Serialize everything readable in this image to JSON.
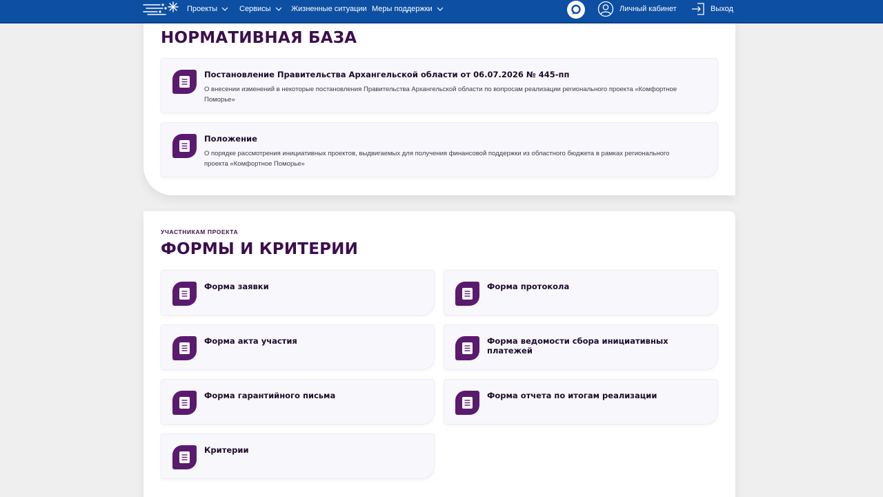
{
  "colors": {
    "header_bg": "#0d4fa3",
    "accent": "#3d0e4d",
    "icon_bg": "#5a1a6e",
    "card_bg": "#f8f8fc",
    "page_bg": "#efefef"
  },
  "icons": {
    "logo": "snowflake-logo-icon",
    "chat": "chat-bubble-icon",
    "account": "user-circle-icon",
    "logout": "logout-icon",
    "document": "document-icon",
    "dropdown": "chevron-down-icon"
  },
  "header": {
    "nav": [
      {
        "label": "Проекты",
        "has_dropdown": true
      },
      {
        "label": "Сервисы",
        "has_dropdown": true
      },
      {
        "label": "Жизненные ситуации",
        "has_dropdown": false
      },
      {
        "label": "Меры поддержки",
        "has_dropdown": true
      }
    ],
    "account_label": "Личный кабинет",
    "logout_label": "Выход"
  },
  "normative": {
    "title": "НОРМАТИВНАЯ БАЗА",
    "docs": [
      {
        "title": "Постановление Правительства Архангельской области от 06.07.2026 № 445-пп",
        "description": "О внесении изменений в некоторые постановления Правительства Архангельской области по вопросам реализации регионального проекта «Комфортное Поморье»"
      },
      {
        "title": "Положение",
        "description": "О порядке рассмотрения инициативных проектов, выдвигаемых для получения финансовой поддержки из областного бюджета в рамках регионального проекта «Комфортное Поморье»"
      }
    ]
  },
  "forms": {
    "eyebrow": "УЧАСТНИКАМ ПРОЕКТА",
    "title": "ФОРМЫ И КРИТЕРИИ",
    "items": [
      {
        "title": "Форма заявки"
      },
      {
        "title": "Форма протокола"
      },
      {
        "title": "Форма акта участия"
      },
      {
        "title": "Форма ведомости сбора инициативных платежей"
      },
      {
        "title": "Форма гарантийного письма"
      },
      {
        "title": "Форма отчета по итогам реализации"
      },
      {
        "title": "Критерии"
      }
    ]
  }
}
